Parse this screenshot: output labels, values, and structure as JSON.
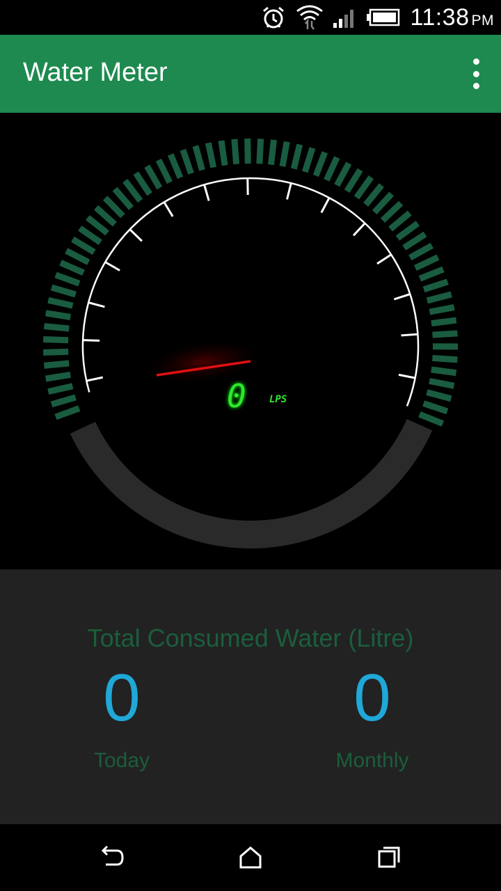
{
  "status_bar": {
    "time": "11:38",
    "ampm": "PM",
    "icons": [
      "alarm-icon",
      "wifi-icon",
      "signal-icon",
      "battery-icon"
    ]
  },
  "app_bar": {
    "title": "Water Meter",
    "menu_icon": "overflow-menu-icon"
  },
  "gauge": {
    "reading": "0",
    "unit": "LPS",
    "colors": {
      "arc_segments": "#1a5c40",
      "needle": "#e01010",
      "digital": "#2ee82e",
      "lower_arc": "#2a2a2a"
    }
  },
  "stats": {
    "title": "Total Consumed Water (Litre)",
    "today": {
      "value": "0",
      "label": "Today"
    },
    "monthly": {
      "value": "0",
      "label": "Monthly"
    },
    "colors": {
      "value": "#1fa8d8",
      "label": "#1b5e3c"
    }
  },
  "nav_bar": {
    "buttons": [
      "back-icon",
      "home-icon",
      "recent-apps-icon"
    ]
  }
}
